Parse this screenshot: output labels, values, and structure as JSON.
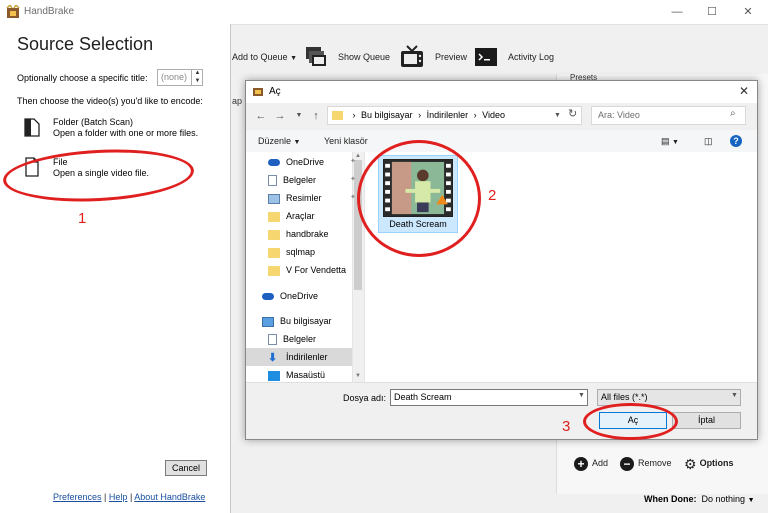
{
  "app": {
    "title": "HandBrake"
  },
  "window_controls": {
    "minimize": "—",
    "maximize": "☐",
    "close": "✕"
  },
  "toolbar": {
    "add_to_queue": "Add to Queue",
    "show_queue": "Show Queue",
    "preview": "Preview",
    "activity_log": "Activity Log"
  },
  "partial_texts": {
    "ap": "ap",
    "presets": "Presets"
  },
  "source_selection": {
    "title": "Source Selection",
    "title_label": "Optionally choose a specific title:",
    "title_value": "(none)",
    "choose_label": "Then choose the video(s) you'd like to encode:",
    "folder_title": "Folder (Batch Scan)",
    "folder_desc": "Open a folder with one or more files.",
    "file_title": "File",
    "file_desc": "Open a single video file.",
    "cancel": "Cancel",
    "links": {
      "preferences": "Preferences",
      "help": "Help",
      "about": "About HandBrake",
      "sep": "|"
    }
  },
  "dialog": {
    "title": "Aç",
    "breadcrumb": [
      "Bu bilgisayar",
      "İndirilenler",
      "Video"
    ],
    "breadcrumb_sep": "›",
    "search_placeholder": "Ara: Video",
    "organize": "Düzenle",
    "new_folder": "Yeni klasör",
    "nav_items": [
      {
        "label": "OneDrive",
        "icon": "cloud-icon",
        "pinned": true
      },
      {
        "label": "Belgeler",
        "icon": "documents-icon",
        "pinned": true
      },
      {
        "label": "Resimler",
        "icon": "pictures-icon",
        "pinned": true
      },
      {
        "label": "Araçlar",
        "icon": "folder-icon"
      },
      {
        "label": "handbrake",
        "icon": "folder-icon"
      },
      {
        "label": "sqlmap",
        "icon": "folder-icon"
      },
      {
        "label": "V For Vendetta",
        "icon": "folder-icon"
      },
      {
        "label": "OneDrive",
        "icon": "cloud-icon"
      },
      {
        "label": "Bu bilgisayar",
        "icon": "computer-icon"
      },
      {
        "label": "Belgeler",
        "icon": "documents-icon"
      },
      {
        "label": "İndirilenler",
        "icon": "download-icon"
      },
      {
        "label": "Masaüstü",
        "icon": "desktop-icon"
      }
    ],
    "file_name": "Death Scream",
    "file_name_label": "Dosya adı:",
    "file_type": "All files (*.*)",
    "open": "Aç",
    "cancel": "İptal"
  },
  "presets": {
    "add": "Add",
    "remove": "Remove",
    "options": "Options"
  },
  "when_done": {
    "label": "When Done:",
    "value": "Do nothing"
  },
  "annotations": [
    "1",
    "2",
    "3"
  ],
  "colors": {
    "annotation": "#e01f1f",
    "accent": "#0078d7",
    "selection": "#cce8ff"
  }
}
